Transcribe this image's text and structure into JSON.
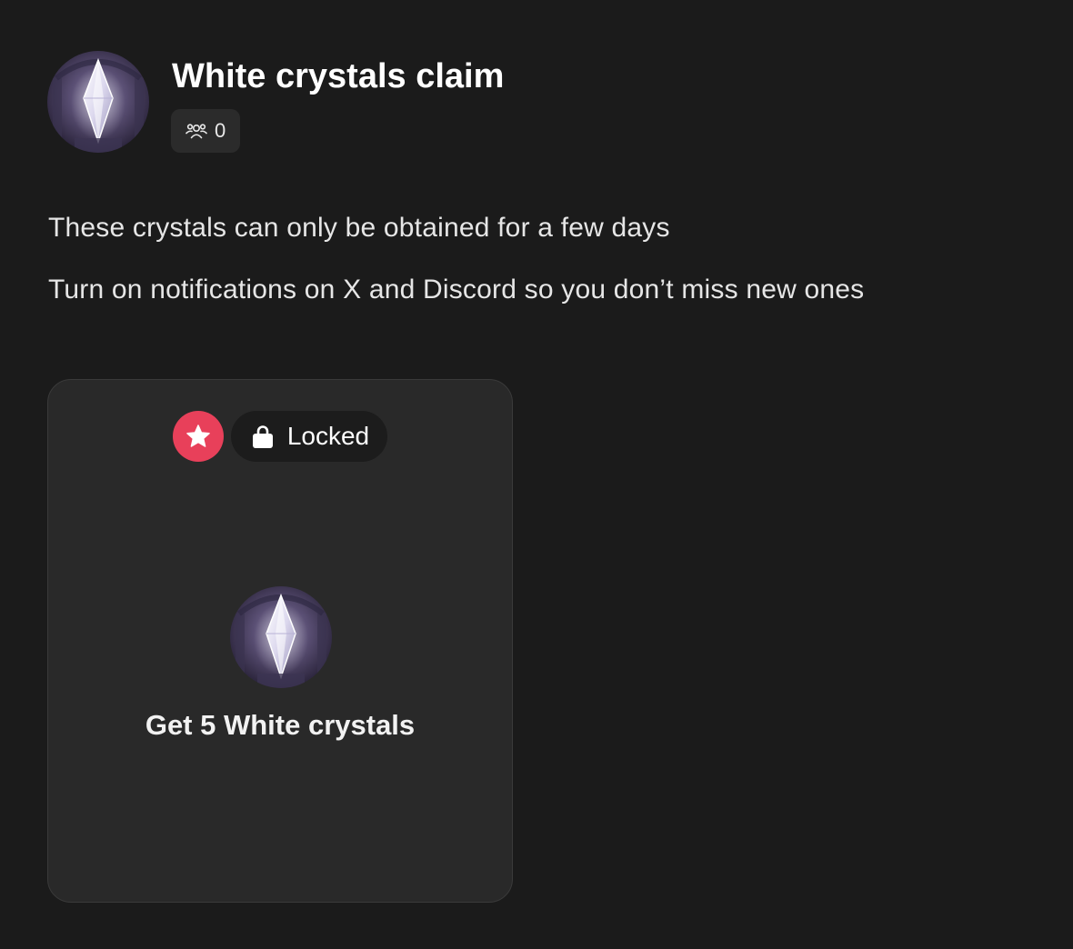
{
  "header": {
    "title": "White crystals claim",
    "members_count": "0",
    "members_icon": "users-group-icon",
    "avatar_icon": "white-crystal-image"
  },
  "description": {
    "line1": "These crystals can only be obtained for a few days",
    "line2": "Turn on notifications on X and Discord so you don’t miss new ones"
  },
  "quest_card": {
    "status_icon": "star-icon",
    "status_label": "Locked",
    "lock_icon": "lock-icon",
    "reward_icon": "white-crystal-image",
    "title": "Get 5 White crystals"
  },
  "colors": {
    "background": "#1b1b1b",
    "card": "#292929",
    "card_border": "#3a3a3a",
    "accent_red": "#e8405a",
    "pill": "#1c1c1c",
    "badge": "#2b2b2b"
  }
}
